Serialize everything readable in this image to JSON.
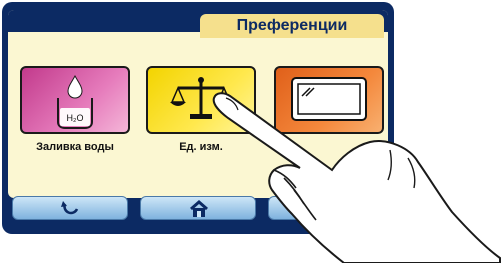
{
  "tab": {
    "title": "Преференции"
  },
  "tiles": [
    {
      "label": "Заливка воды",
      "icon": "water-fill-icon"
    },
    {
      "label": "Ед. изм.",
      "icon": "scale-icon"
    },
    {
      "label": "",
      "icon": "display-icon"
    }
  ],
  "water_icon": {
    "text": "H₂O"
  },
  "nav": [
    {
      "icon": "refresh-icon"
    },
    {
      "icon": "home-icon"
    },
    {
      "icon": "back-icon"
    }
  ],
  "colors": {
    "frame": "#0c2a63",
    "panel": "#fbf7d2",
    "tab": "#f5e08d",
    "tile1": "#c23a8c",
    "tile2": "#f3d400",
    "tile3": "#e0601a"
  }
}
